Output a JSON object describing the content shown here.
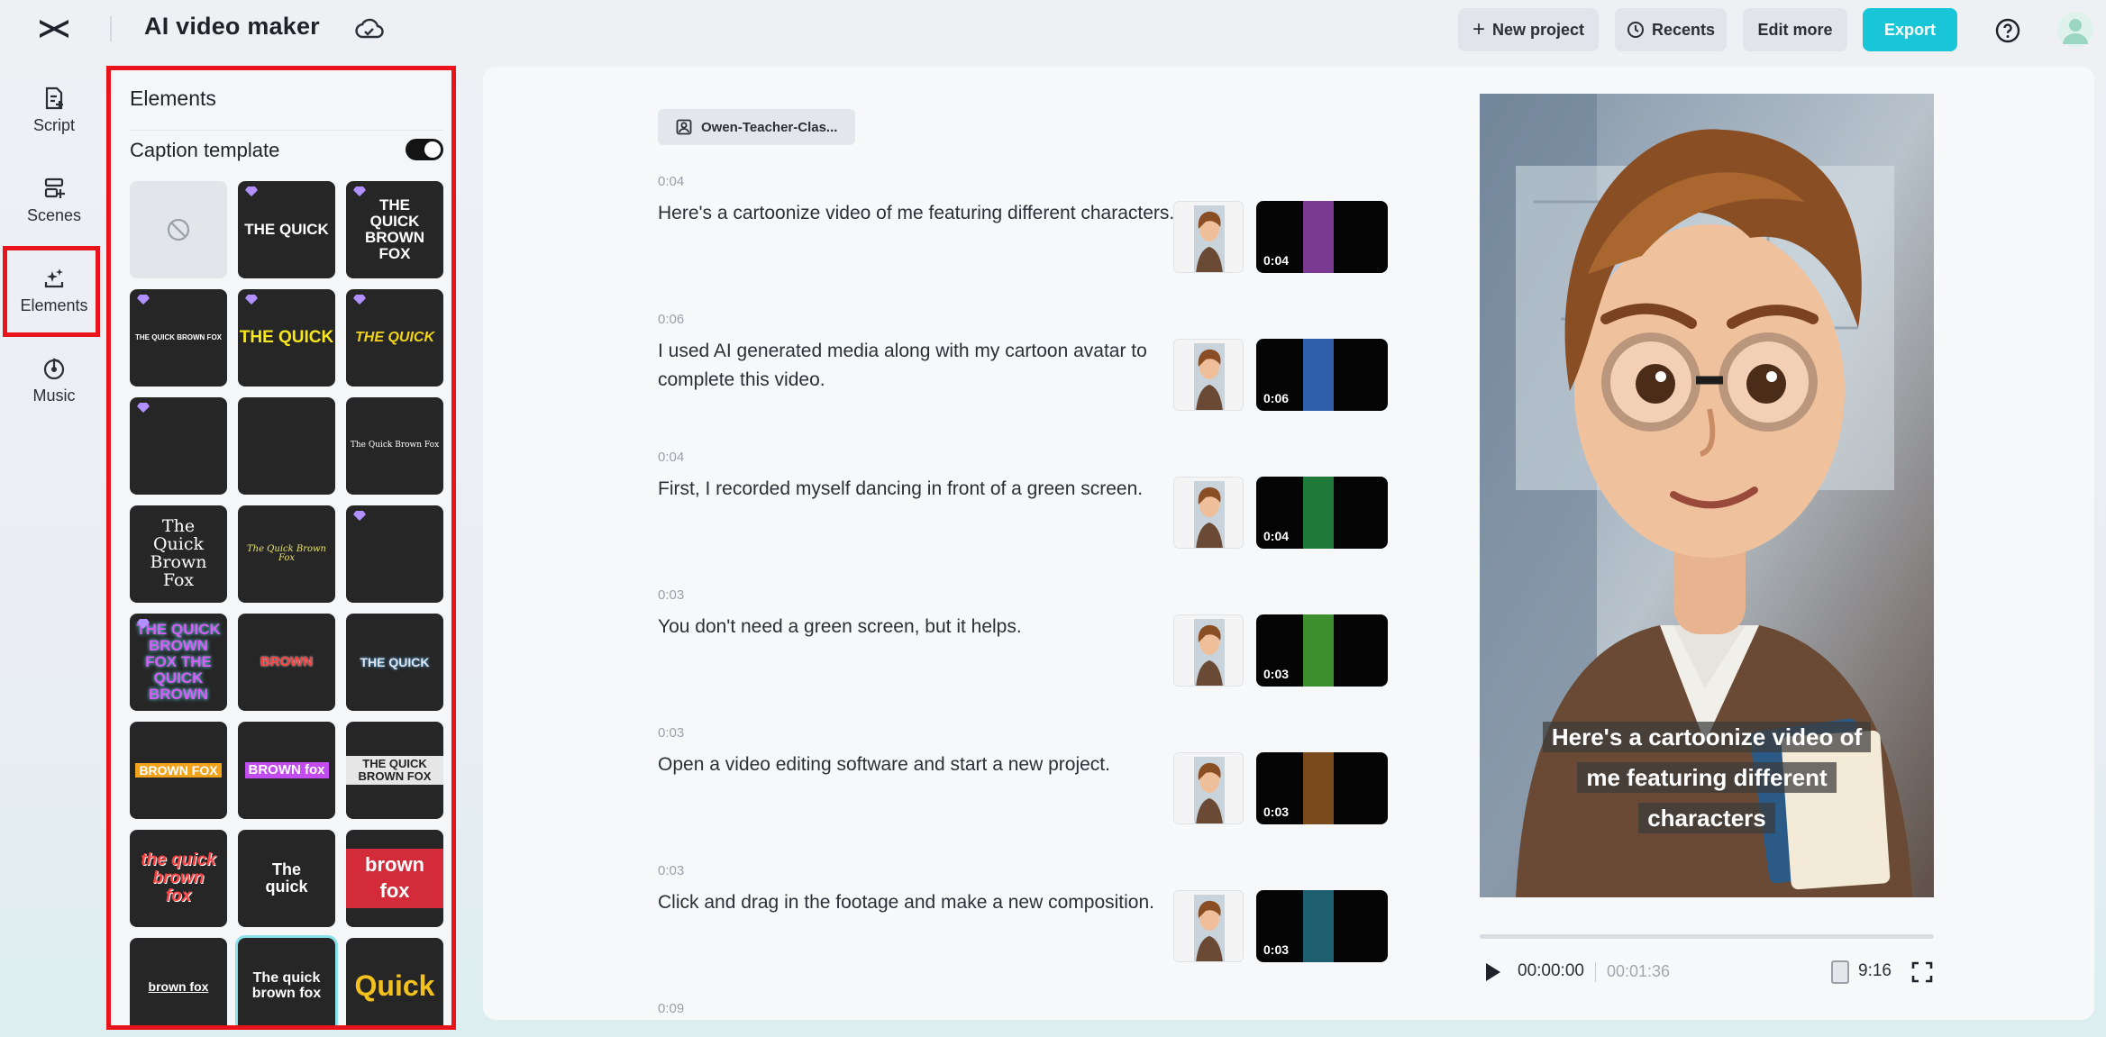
{
  "header": {
    "app_title": "AI video maker",
    "new_project": "New project",
    "recents": "Recents",
    "edit_more": "Edit more",
    "export": "Export"
  },
  "nav": {
    "script": "Script",
    "scenes": "Scenes",
    "elements": "Elements",
    "music": "Music"
  },
  "panel": {
    "title": "Elements",
    "caption_template_label": "Caption template",
    "caption_template_enabled": true,
    "templates": [
      {
        "text": "",
        "kind": "none"
      },
      {
        "text": "THE QUICK",
        "premium": true
      },
      {
        "text": "THE QUICK BROWN FOX",
        "premium": true
      },
      {
        "text": "THE QUICK BROWN FOX",
        "premium": true
      },
      {
        "text": "THE QUICK",
        "premium": true
      },
      {
        "text": "THE QUICK",
        "premium": true
      },
      {
        "text": "",
        "premium": true
      },
      {
        "text": "",
        "premium": false
      },
      {
        "text": "The Quick Brown Fox",
        "premium": false
      },
      {
        "text": "The Quick Brown Fox",
        "premium": false
      },
      {
        "text": "The Quick Brown Fox",
        "premium": false
      },
      {
        "text": "",
        "premium": true
      },
      {
        "text": "THE QUICK BROWN FOX THE QUICK BROWN",
        "premium": true
      },
      {
        "text": "BROWN",
        "premium": false
      },
      {
        "text": "THE QUICK",
        "premium": false
      },
      {
        "text": "BROWN FOX",
        "premium": false
      },
      {
        "text": "BROWN fox",
        "premium": false
      },
      {
        "text": "THE QUICK BROWN FOX",
        "premium": false
      },
      {
        "text": "the quick brown fox",
        "premium": false
      },
      {
        "text": "The quick",
        "premium": false
      },
      {
        "text": "brown fox",
        "premium": false
      },
      {
        "text": "brown fox",
        "premium": false
      },
      {
        "text": "The quick brown fox",
        "premium": false,
        "selected": true
      },
      {
        "text": "Quick",
        "premium": false
      }
    ]
  },
  "script": {
    "character_chip": "Owen-Teacher-Clas...",
    "scenes": [
      {
        "time": "0:04",
        "text": "Here's a cartoonize video of me featuring different characters.",
        "media_duration": "0:04",
        "strip_color": "#7b3a92"
      },
      {
        "time": "0:06",
        "text": "I used AI generated media along with my cartoon avatar to complete this video.",
        "media_duration": "0:06",
        "strip_color": "#2e5fa8"
      },
      {
        "time": "0:04",
        "text": "First, I recorded myself dancing in front of a green screen.",
        "media_duration": "0:04",
        "strip_color": "#1f7a3a"
      },
      {
        "time": "0:03",
        "text": "You don't need a green screen, but it helps.",
        "media_duration": "0:03",
        "strip_color": "#3d8f2e"
      },
      {
        "time": "0:03",
        "text": "Open a video editing software and start a new project.",
        "media_duration": "0:03",
        "strip_color": "#7a4a1c"
      },
      {
        "time": "0:03",
        "text": "Click and drag in the footage and make a new composition.",
        "media_duration": "0:03",
        "strip_color": "#1d5f6e"
      }
    ],
    "next_time": "0:09"
  },
  "preview": {
    "caption_lines": [
      "Here's a cartoonize video of",
      "me featuring different",
      "characters"
    ],
    "current_time": "00:00:00",
    "total_time": "00:01:36",
    "aspect_ratio": "9:16"
  },
  "colors": {
    "accent": "#18c6d7",
    "highlight": "#e8131b"
  }
}
